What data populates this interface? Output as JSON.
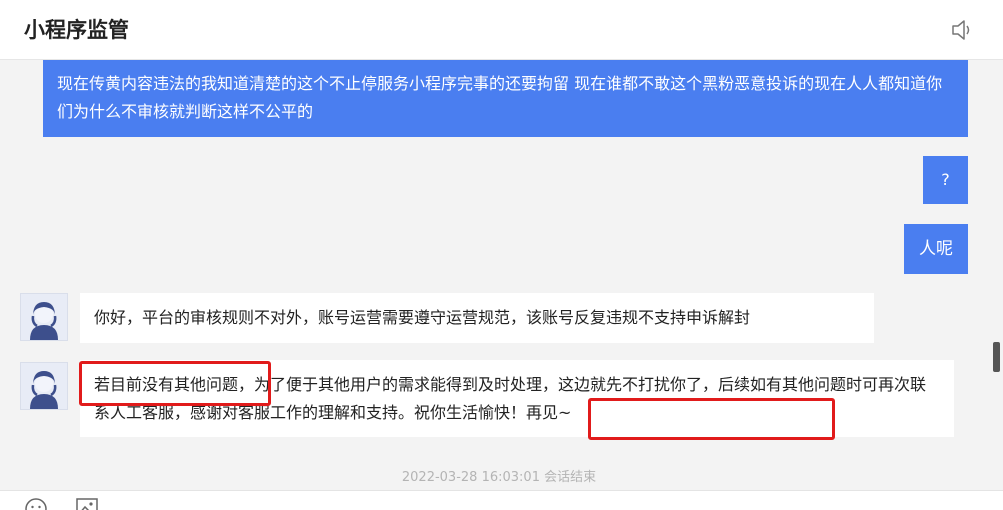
{
  "header": {
    "title": "小程序监管",
    "speaker_icon": "speaker-icon"
  },
  "messages": [
    {
      "side": "outgoing",
      "text": "现在传黄内容违法的我知道清楚的这个不止停服务小程序完事的还要拘留 现在谁都不敢这个黑粉恶意投诉的现在人人都知道你们为什么不审核就判断这样不公平的"
    },
    {
      "side": "outgoing",
      "text": "?"
    },
    {
      "side": "outgoing",
      "text": "人呢"
    },
    {
      "side": "incoming",
      "text": "你好，平台的审核规则不对外，账号运营需要遵守运营规范，该账号反复违规不支持申诉解封"
    },
    {
      "side": "incoming",
      "text": "若目前没有其他问题，为了便于其他用户的需求能得到及时处理，这边就先不打扰你了，后续如有其他问题时可再次联系人工客服，感谢对客服工作的理解和支持。祝你生活愉快！再见~"
    }
  ],
  "timestamp": "2022-03-28 16:03:01 会话结束",
  "colors": {
    "outgoing_bubble": "#4a7ef0",
    "incoming_bubble": "#ffffff",
    "highlight_box": "#e11b1b",
    "background": "#f3f3f3"
  },
  "toolbar": {
    "emoji_icon": "emoji-icon",
    "image_icon": "image-icon"
  }
}
